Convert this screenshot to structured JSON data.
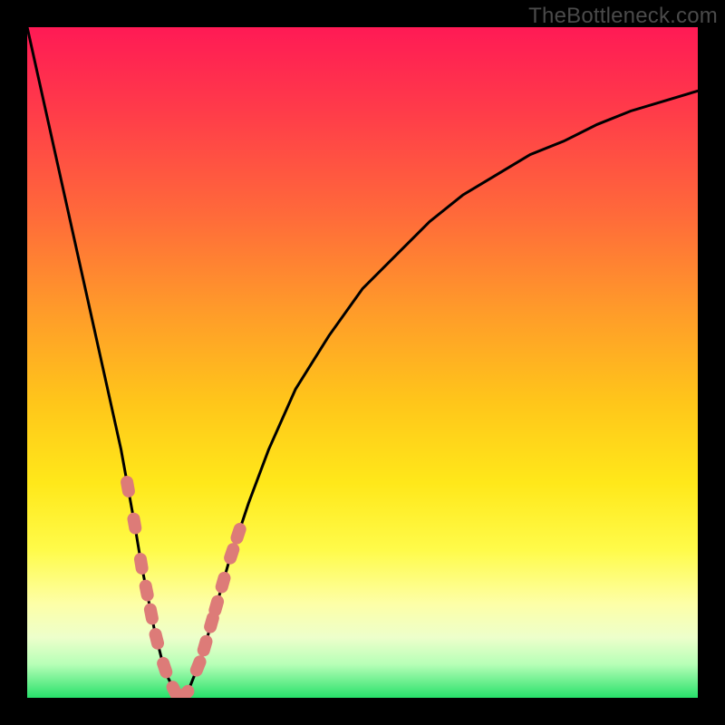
{
  "watermark": "TheBottleneck.com",
  "chart_data": {
    "type": "line",
    "title": "",
    "xlabel": "",
    "ylabel": "",
    "xlim": [
      0,
      100
    ],
    "ylim": [
      0,
      100
    ],
    "grid": false,
    "legend": false,
    "series": [
      {
        "name": "bottleneck-curve",
        "x": [
          0,
          2,
          4,
          6,
          8,
          10,
          12,
          14,
          16,
          17,
          18,
          19,
          20,
          21,
          22,
          23,
          24,
          26,
          28,
          30,
          33,
          36,
          40,
          45,
          50,
          55,
          60,
          65,
          70,
          75,
          80,
          85,
          90,
          95,
          100
        ],
        "y": [
          100,
          91,
          82,
          73,
          64,
          55,
          46,
          37,
          26,
          20,
          15,
          10,
          6,
          3,
          1,
          0,
          1,
          6,
          13,
          20,
          29,
          37,
          46,
          54,
          61,
          66,
          71,
          75,
          78,
          81,
          83,
          85.5,
          87.5,
          89,
          90.5
        ]
      }
    ],
    "markers": [
      {
        "name": "left-cluster",
        "points": [
          {
            "x": 15.0,
            "y": 33
          },
          {
            "x": 16.0,
            "y": 27
          },
          {
            "x": 17.0,
            "y": 21
          },
          {
            "x": 17.8,
            "y": 16
          },
          {
            "x": 18.5,
            "y": 11
          },
          {
            "x": 19.3,
            "y": 7
          },
          {
            "x": 20.5,
            "y": 3
          },
          {
            "x": 22.0,
            "y": 0.8
          },
          {
            "x": 23.5,
            "y": 0.5
          }
        ]
      },
      {
        "name": "right-cluster",
        "points": [
          {
            "x": 25.5,
            "y": 4
          },
          {
            "x": 26.5,
            "y": 8
          },
          {
            "x": 27.5,
            "y": 12
          },
          {
            "x": 28.2,
            "y": 15
          },
          {
            "x": 29.2,
            "y": 19
          },
          {
            "x": 30.5,
            "y": 23
          },
          {
            "x": 31.5,
            "y": 27
          }
        ]
      }
    ],
    "colors": {
      "curve": "#000000",
      "marker": "#dd7b78",
      "gradient_top": "#ff1a55",
      "gradient_bottom": "#27e06a"
    }
  }
}
